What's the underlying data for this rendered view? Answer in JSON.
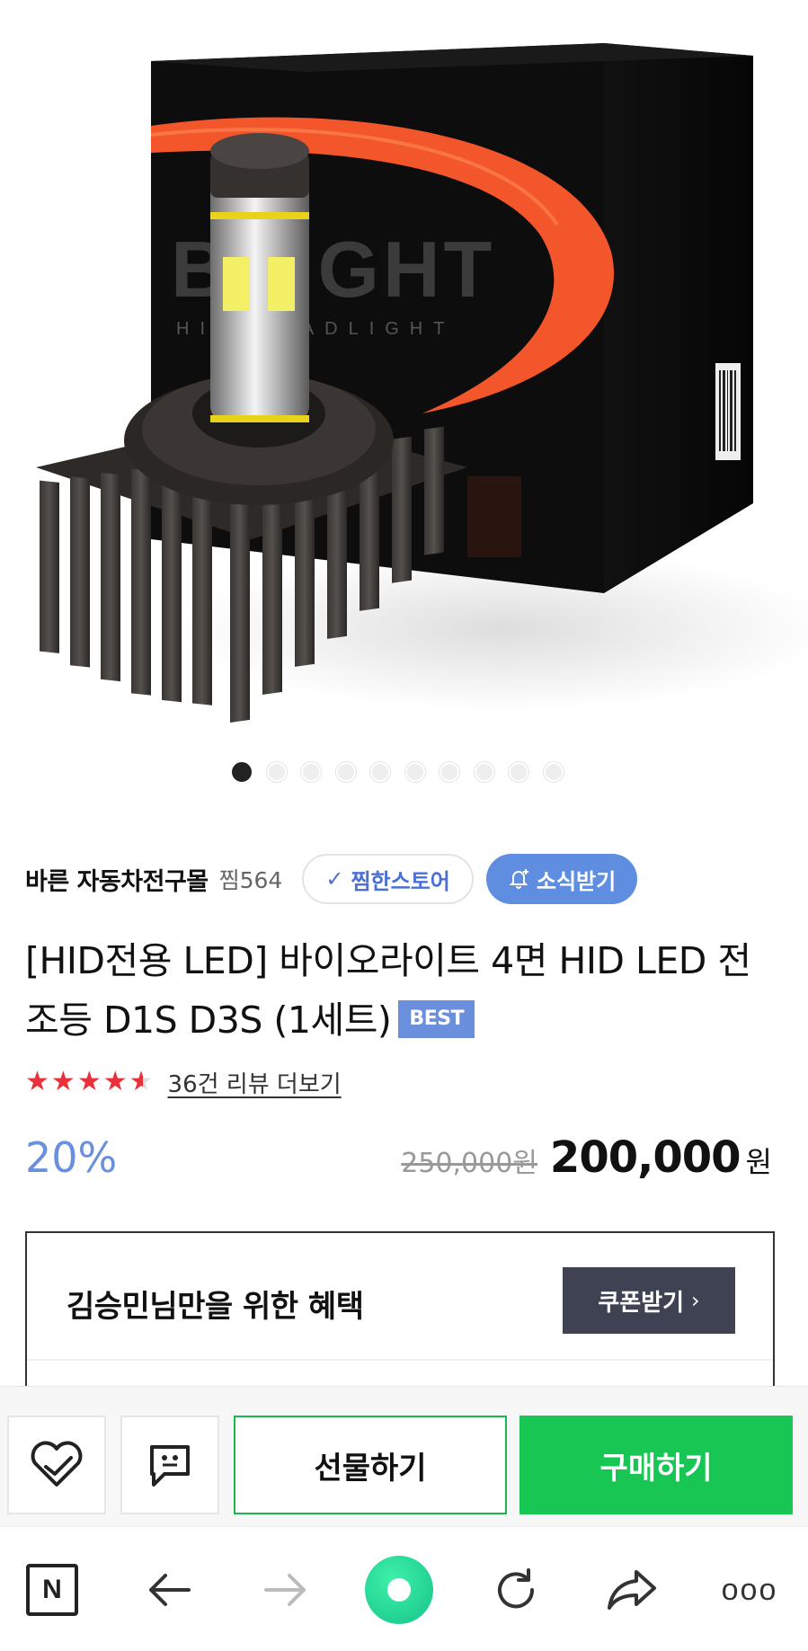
{
  "product_image": {
    "alt": "BRIGHT HID HEADLIGHT LED bulb with box",
    "box_brand_text": "BRIGHT",
    "box_sub_text": "HID HEADLIGHT",
    "carousel_total": 10,
    "carousel_active": 1
  },
  "store": {
    "name": "바른 자동차전구몰",
    "zzim_count": "찜564",
    "zzim_store_label": "찜한스토어",
    "news_label": "소식받기"
  },
  "product": {
    "title": "[HID전용 LED] 바이오라이트 4면 HID LED 전조등 D1S D3S (1세트)",
    "badge": "BEST",
    "rating": 4.5,
    "review_link": "36건 리뷰 더보기",
    "discount": "20%",
    "original_price": "250,000원",
    "sale_price": "200,000",
    "currency": "원"
  },
  "benefit": {
    "title": "김승민님만을 위한 혜택",
    "coupon_label": "쿠폰받기",
    "coupon_chevron": "›"
  },
  "actions": {
    "gift_label": "선물하기",
    "buy_label": "구매하기"
  },
  "browser_nav": {
    "home_label": "N",
    "more_label": "ooo"
  },
  "colors": {
    "accent_blue": "#6a8fdc",
    "buy_green": "#17c653",
    "star_red": "#e8313a",
    "coupon_dark": "#3e4252"
  }
}
